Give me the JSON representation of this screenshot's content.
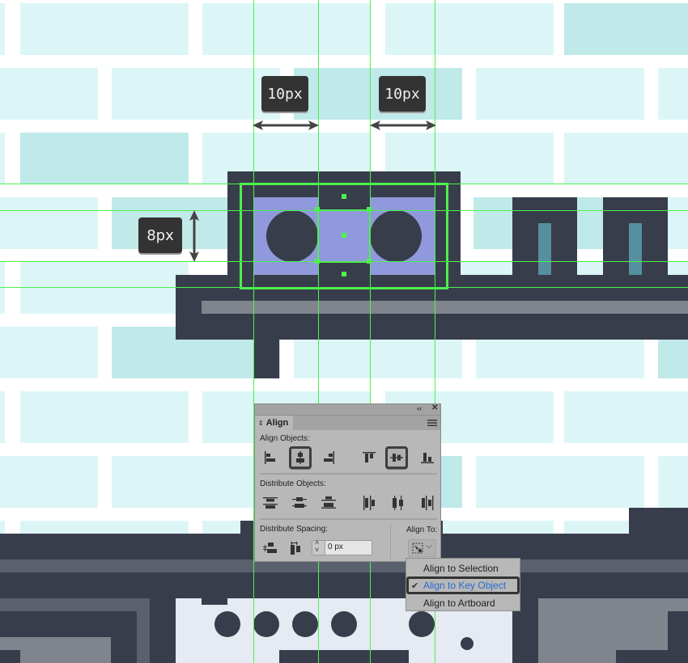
{
  "canvas": {
    "measurements": [
      {
        "id": "gap-left",
        "label": "10px"
      },
      {
        "id": "gap-right",
        "label": "10px"
      },
      {
        "id": "height-gap",
        "label": "8px"
      }
    ],
    "colors": {
      "brick_light": "#dcf6f7",
      "brick_dark": "#c0e9e9",
      "outline_dark": "#383d4b",
      "selection_fill": "#8f99db",
      "accent_teal": "#568f9d",
      "guide_green": "#4cf24c",
      "panel_gray": "#b8b8b8"
    }
  },
  "align_panel": {
    "title": "Align",
    "collapse_icon": "double-chevron-left",
    "close_icon": "x",
    "menu_icon": "hamburger",
    "align_objects_label": "Align Objects:",
    "align_objects_buttons": [
      {
        "name": "horizontal-align-left",
        "selected": false
      },
      {
        "name": "horizontal-align-center",
        "selected": true
      },
      {
        "name": "horizontal-align-right",
        "selected": false
      },
      {
        "name": "vertical-align-top",
        "selected": false
      },
      {
        "name": "vertical-align-center",
        "selected": true
      },
      {
        "name": "vertical-align-bottom",
        "selected": false
      }
    ],
    "distribute_objects_label": "Distribute Objects:",
    "distribute_objects_buttons": [
      "vertical-distribute-top",
      "vertical-distribute-center",
      "vertical-distribute-bottom",
      "horizontal-distribute-left",
      "horizontal-distribute-center",
      "horizontal-distribute-right"
    ],
    "distribute_spacing_label": "Distribute Spacing:",
    "spacing_value": "0 px",
    "align_to_label": "Align To:"
  },
  "align_to_menu": {
    "items": [
      {
        "label": "Align to Selection",
        "checked": false
      },
      {
        "label": "Align to Key Object",
        "checked": true
      },
      {
        "label": "Align to Artboard",
        "checked": false
      }
    ],
    "check_glyph": "✔"
  }
}
